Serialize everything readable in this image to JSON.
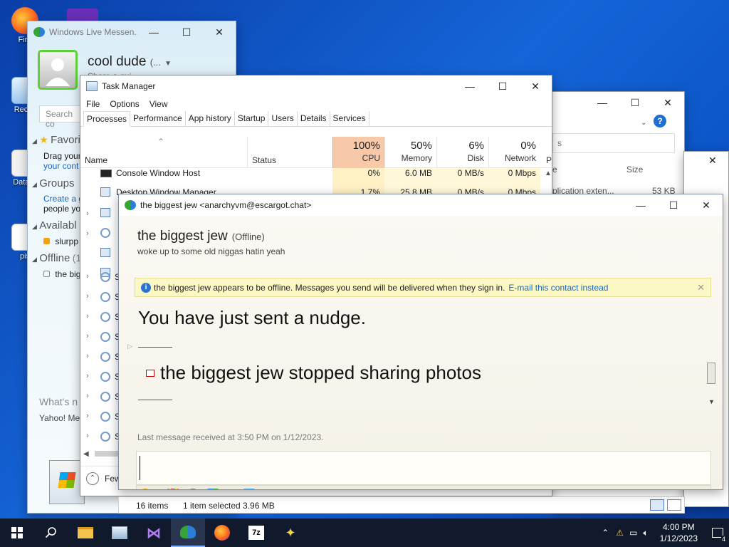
{
  "desktop": {
    "icons": [
      {
        "label": "Fire"
      },
      {
        "label": "Recyc"
      },
      {
        "label": "DataW"
      },
      {
        "label": "pis"
      }
    ]
  },
  "messenger": {
    "title": "Windows Live Messen...",
    "display_name": "cool dude",
    "status_dots": "(...",
    "share_hint": "Share a qui",
    "search_placeholder": "Search co",
    "favorites_header": "Favori",
    "favorites_hint1": "Drag your",
    "favorites_hint2": "your cont",
    "groups_header": "Groups",
    "groups_hint1": "Create a g",
    "groups_hint2": "people yo",
    "available_header": "Availabl",
    "available_contact": "slurpp",
    "offline_header": "Offline",
    "offline_count": "(1",
    "offline_contact": "the bigg",
    "whats_new": "What's n",
    "yahoo": "Yahoo! Me"
  },
  "taskmanager": {
    "title": "Task Manager",
    "menu": [
      "File",
      "Options",
      "View"
    ],
    "tabs": [
      "Processes",
      "Performance",
      "App history",
      "Startup",
      "Users",
      "Details",
      "Services"
    ],
    "columns": {
      "name": "Name",
      "status": "Status",
      "cpu_pct": "100%",
      "cpu": "CPU",
      "mem_pct": "50%",
      "mem": "Memory",
      "disk_pct": "6%",
      "disk": "Disk",
      "net_pct": "0%",
      "net": "Network",
      "power": "P"
    },
    "rows": [
      {
        "name": "Console Window Host",
        "cpu": "0%",
        "mem": "6.0 MB",
        "disk": "0 MB/s",
        "net": "0 Mbps"
      },
      {
        "name": "Desktop Window Manager",
        "cpu": "1.7%",
        "mem": "25.8 MB",
        "disk": "0 MB/s",
        "net": "0 Mbps"
      }
    ],
    "row_prefix": [
      "S",
      "S",
      "S",
      "S",
      "S",
      "S",
      "S",
      "S",
      "S"
    ],
    "fewer_details": "Few",
    "status_items": "16 items",
    "status_selected": "1 item selected  3.96 MB"
  },
  "explorer": {
    "col_size": "Size",
    "col_type": "e",
    "row_type": "plication exten...",
    "row_size": "53 KB",
    "search_frag": "s"
  },
  "conversation": {
    "title": "the biggest jew <anarchyvm@escargot.chat>",
    "contact_name": "the biggest jew",
    "contact_status": "(Offline)",
    "personal_message": "woke up to some old niggas hatin yeah",
    "info_text": "the biggest jew appears to be offline. Messages you send will be delivered when they sign in.",
    "info_link": "E-mail this contact instead",
    "nudge": "You have just sent a nudge.",
    "photos": "the biggest jew stopped sharing photos",
    "last_message": "Last message received at 3:50 PM on 1/12/2023."
  },
  "taskbar": {
    "time": "4:00 PM",
    "date": "1/12/2023",
    "notifications": "4"
  }
}
